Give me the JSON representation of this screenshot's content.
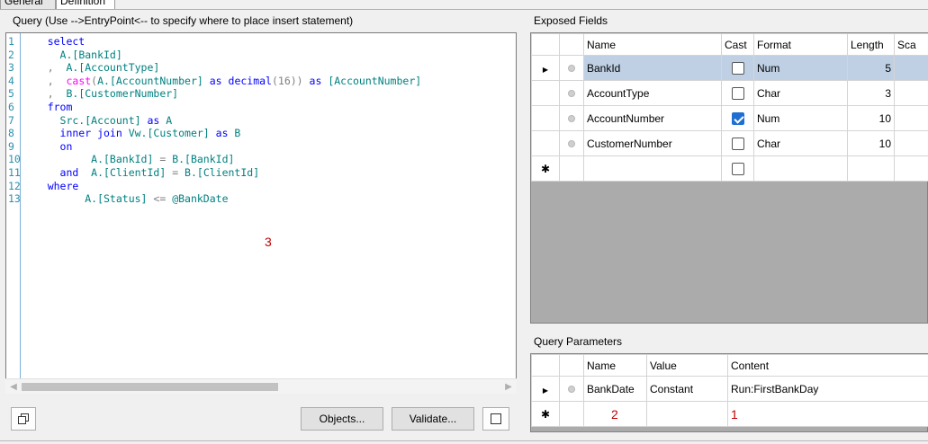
{
  "tabs": [
    "General",
    "Definition"
  ],
  "query_title": "Query (Use -->EntryPoint<-- to specify where to place insert statement)",
  "code_lines": [
    {
      "n": "1",
      "parts": [
        {
          "c": "kw",
          "t": "    select"
        }
      ]
    },
    {
      "n": "2",
      "parts": [
        {
          "c": "pl",
          "t": "      "
        },
        {
          "c": "id",
          "t": "A.[BankId]"
        }
      ]
    },
    {
      "n": "3",
      "parts": [
        {
          "c": "gr",
          "t": "    , "
        },
        {
          "c": "id",
          "t": " A.[AccountType]"
        }
      ]
    },
    {
      "n": "4",
      "parts": [
        {
          "c": "gr",
          "t": "    , "
        },
        {
          "c": "fn",
          "t": " cast"
        },
        {
          "c": "gr",
          "t": "("
        },
        {
          "c": "id",
          "t": "A.[AccountNumber]"
        },
        {
          "c": "kw",
          "t": " as "
        },
        {
          "c": "ty",
          "t": "decimal"
        },
        {
          "c": "gr",
          "t": "(16))"
        },
        {
          "c": "kw",
          "t": " as "
        },
        {
          "c": "id",
          "t": "[AccountNumber]"
        }
      ]
    },
    {
      "n": "5",
      "parts": [
        {
          "c": "gr",
          "t": "    , "
        },
        {
          "c": "id",
          "t": " B.[CustomerNumber]"
        }
      ]
    },
    {
      "n": "6",
      "parts": [
        {
          "c": "kw",
          "t": "    from"
        }
      ]
    },
    {
      "n": "7",
      "parts": [
        {
          "c": "id",
          "t": "      Src.[Account]"
        },
        {
          "c": "kw",
          "t": " as "
        },
        {
          "c": "id",
          "t": "A"
        }
      ]
    },
    {
      "n": "8",
      "parts": [
        {
          "c": "kw",
          "t": "      inner join "
        },
        {
          "c": "id",
          "t": "Vw.[Customer]"
        },
        {
          "c": "kw",
          "t": " as "
        },
        {
          "c": "id",
          "t": "B"
        }
      ]
    },
    {
      "n": "9",
      "parts": [
        {
          "c": "kw",
          "t": "      on"
        }
      ]
    },
    {
      "n": "10",
      "parts": [
        {
          "c": "id",
          "t": "           A.[BankId]"
        },
        {
          "c": "gr",
          "t": " = "
        },
        {
          "c": "id",
          "t": "B.[BankId]"
        }
      ]
    },
    {
      "n": "11",
      "parts": [
        {
          "c": "kw",
          "t": "      and  "
        },
        {
          "c": "id",
          "t": "A.[ClientId]"
        },
        {
          "c": "gr",
          "t": " = "
        },
        {
          "c": "id",
          "t": "B.[ClientId]"
        }
      ]
    },
    {
      "n": "12",
      "parts": [
        {
          "c": "kw",
          "t": "    where"
        }
      ]
    },
    {
      "n": "13",
      "parts": [
        {
          "c": "id",
          "t": "          A.[Status]"
        },
        {
          "c": "gr",
          "t": " <= "
        },
        {
          "c": "id",
          "t": "@BankDate"
        }
      ]
    }
  ],
  "markers": {
    "one": "1",
    "two": "2",
    "three": "3"
  },
  "buttons": {
    "objects": "Objects...",
    "validate": "Validate..."
  },
  "exposed_fields": {
    "title": "Exposed Fields",
    "columns": [
      "Name",
      "Cast",
      "Format",
      "Length",
      "Sca"
    ],
    "rows": [
      {
        "name": "BankId",
        "cast": false,
        "format": "Num",
        "length": "5",
        "selected": true
      },
      {
        "name": "AccountType",
        "cast": false,
        "format": "Char",
        "length": "3",
        "selected": false
      },
      {
        "name": "AccountNumber",
        "cast": true,
        "format": "Num",
        "length": "10",
        "selected": false
      },
      {
        "name": "CustomerNumber",
        "cast": false,
        "format": "Char",
        "length": "10",
        "selected": false
      }
    ]
  },
  "query_parameters": {
    "title": "Query Parameters",
    "columns": [
      "Name",
      "Value",
      "Content"
    ],
    "rows": [
      {
        "name": "BankDate",
        "value": "Constant",
        "content": "Run:FirstBankDay"
      }
    ]
  }
}
